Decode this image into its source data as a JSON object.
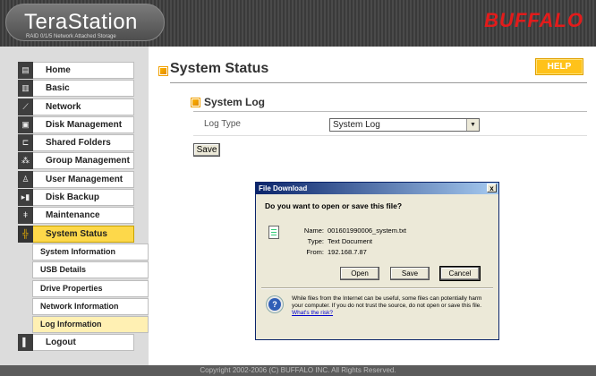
{
  "header": {
    "logo_title": "TeraStation",
    "logo_subtitle": "RAID 0/1/5 Network Attached Storage",
    "brand": "BUFFALO"
  },
  "sidebar": {
    "items": [
      {
        "label": "Home",
        "icon": "home-icon"
      },
      {
        "label": "Basic",
        "icon": "basic-icon"
      },
      {
        "label": "Network",
        "icon": "network-icon"
      },
      {
        "label": "Disk Management",
        "icon": "disk-icon"
      },
      {
        "label": "Shared Folders",
        "icon": "folder-icon"
      },
      {
        "label": "Group Management",
        "icon": "group-icon"
      },
      {
        "label": "User Management",
        "icon": "user-icon"
      },
      {
        "label": "Disk Backup",
        "icon": "backup-icon"
      },
      {
        "label": "Maintenance",
        "icon": "tools-icon"
      },
      {
        "label": "System Status",
        "icon": "status-icon",
        "active": true
      }
    ],
    "subitems": [
      {
        "label": "System Information"
      },
      {
        "label": "USB Details"
      },
      {
        "label": "Drive Properties"
      },
      {
        "label": "Network Information"
      },
      {
        "label": "Log Information",
        "active": true
      }
    ],
    "logout": {
      "label": "Logout",
      "icon": "logout-icon"
    }
  },
  "main": {
    "title": "System Status",
    "help": "HELP",
    "section_title": "System Log",
    "log_type_label": "Log Type",
    "log_type_value": "System Log",
    "save_label": "Save"
  },
  "dialog": {
    "title": "File Download",
    "close": "x",
    "question": "Do you want to open or save this file?",
    "name_label": "Name:",
    "name_value": "001601990006_system.txt",
    "type_label": "Type:",
    "type_value": "Text Document",
    "from_label": "From:",
    "from_value": "192.168.7.87",
    "open_label": "Open",
    "save_label": "Save",
    "cancel_label": "Cancel",
    "warning_text": "While files from the Internet can be useful, some files can potentially harm your computer. If you do not trust the source, do not open or save this file.",
    "risk_link": "What's the risk?"
  },
  "footer": {
    "copyright": "Copyright 2002-2006 (C) BUFFALO INC. All Rights Reserved."
  },
  "colors": {
    "accent": "#ffc21a",
    "active_nav": "#fdd84a",
    "brand_red": "#e31b1b",
    "header_bg": "#3a3a3a"
  }
}
